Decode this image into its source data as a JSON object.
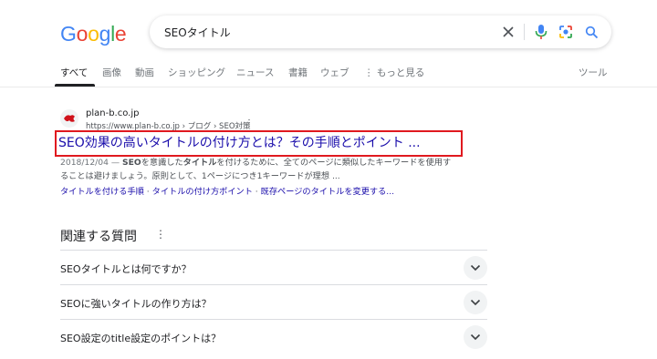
{
  "logo": {
    "letters": [
      "G",
      "o",
      "o",
      "g",
      "l",
      "e"
    ],
    "colors": [
      "#4285f4",
      "#ea4335",
      "#fbbc05",
      "#4285f4",
      "#34a853",
      "#ea4335"
    ]
  },
  "search": {
    "value": "SEOタイトル"
  },
  "tabs": [
    {
      "label": "すべて",
      "active": true
    },
    {
      "label": "画像"
    },
    {
      "label": "動画"
    },
    {
      "label": "ショッピング"
    },
    {
      "label": "ニュース"
    },
    {
      "label": "書籍"
    },
    {
      "label": "ウェブ"
    },
    {
      "label": "もっと見る"
    }
  ],
  "tools_label": "ツール",
  "result": {
    "site_name": "plan-b.co.jp",
    "url": "https://www.plan-b.co.jp › ブログ › SEO対策",
    "title": "SEO効果の高いタイトルの付け方とは？その手順とポイント ...",
    "snippet_date": "2018/12/04 —",
    "snippet_line1_a": "SEO",
    "snippet_line1_b": "を意識した",
    "snippet_line1_c": "タイトル",
    "snippet_line1_d": "を付けるために、全てのページに類似したキーワードを使用す",
    "snippet_line2": "ることは避けましょう。原則として、1ページにつき1キーワードが理想 ...",
    "sitelinks": [
      "タイトルを付ける手順",
      "タイトルの付け方ポイント",
      "既存ページのタイトルを変更する..."
    ],
    "sitelink_sep": " · "
  },
  "paa": {
    "title": "関連する質問",
    "questions": [
      "SEOタイトルとは何ですか？",
      "SEOに強いタイトルの作り方は？",
      "SEO設定のtitle設定のポイントは？"
    ]
  },
  "colors": {
    "link": "#1a0dab",
    "highlight": "#e0191f"
  }
}
